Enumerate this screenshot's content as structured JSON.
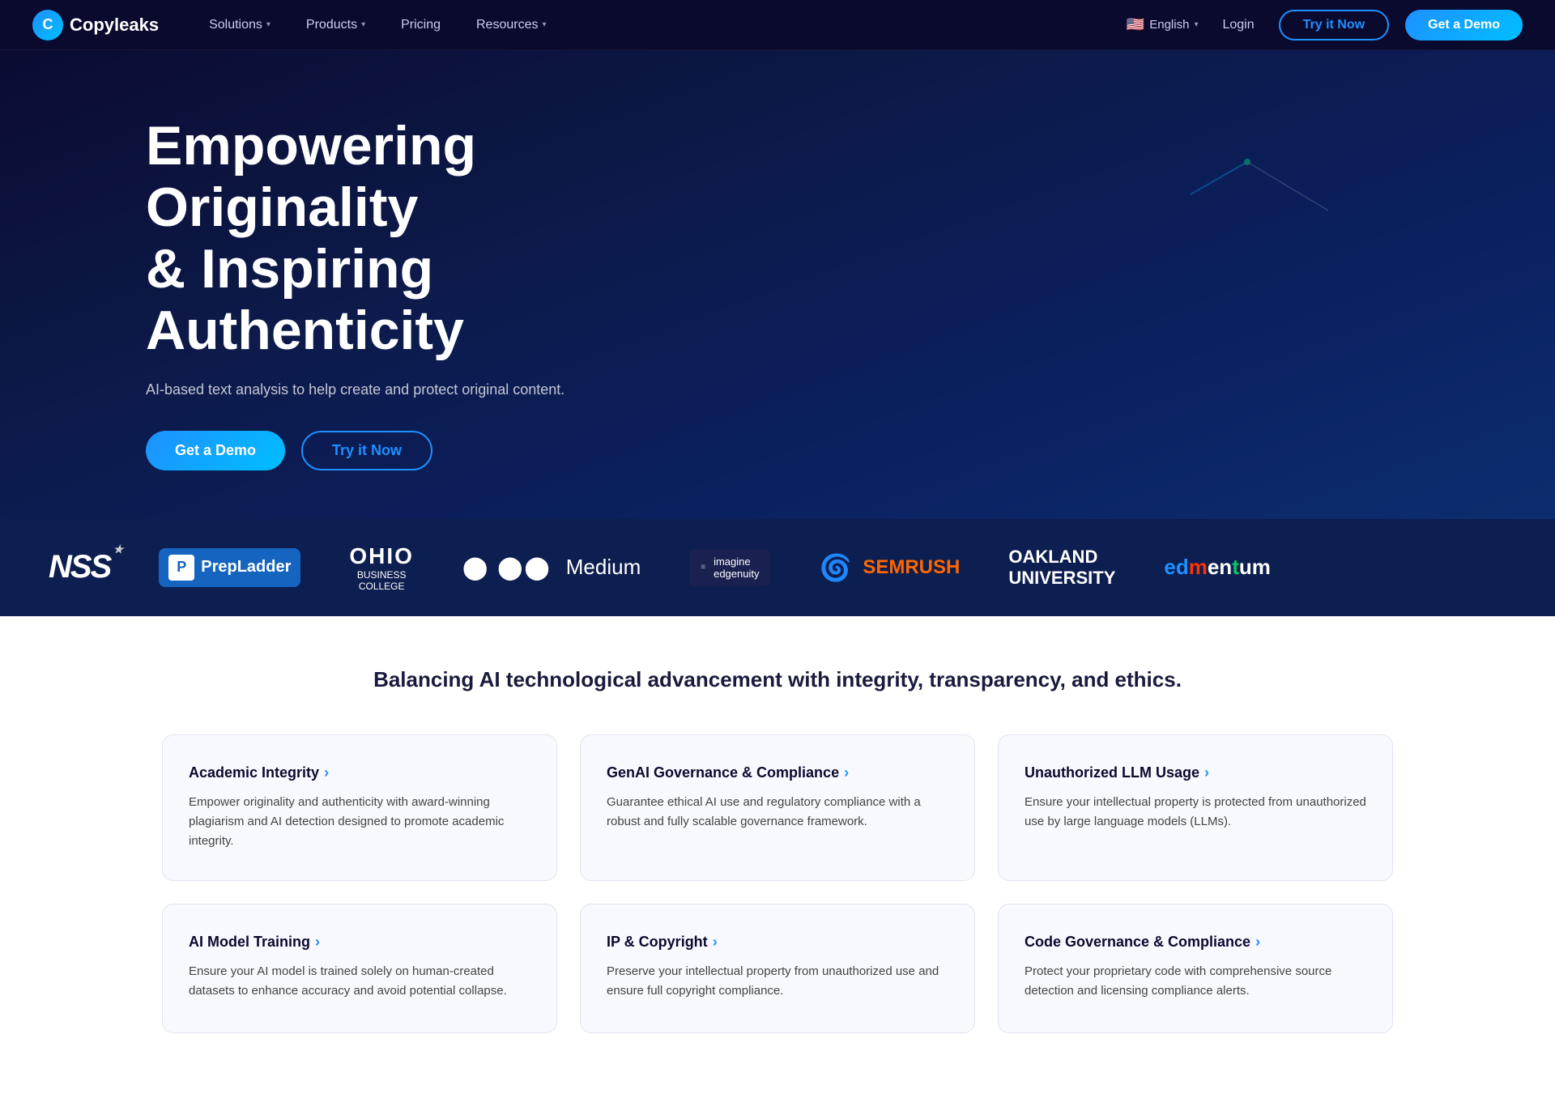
{
  "brand": {
    "logo_letter": "C",
    "logo_name": "Copyleaks"
  },
  "navbar": {
    "solutions_label": "Solutions",
    "products_label": "Products",
    "pricing_label": "Pricing",
    "resources_label": "Resources",
    "language": "English",
    "login_label": "Login",
    "try_btn_label": "Try it Now",
    "demo_btn_label": "Get a Demo"
  },
  "hero": {
    "title_line1": "Empowering Originality",
    "title_line2": "& Inspiring Authenticity",
    "subtitle": "AI-based text analysis to help create and protect original content.",
    "demo_btn": "Get a Demo",
    "try_btn": "Try it Now"
  },
  "logos": [
    {
      "id": "nss",
      "text": "NSS"
    },
    {
      "id": "prepladder",
      "text": "PrepLadder"
    },
    {
      "id": "ohio",
      "text": "OHIO BUSINESS COLLEGE"
    },
    {
      "id": "medium",
      "text": "● ●● Medium"
    },
    {
      "id": "imagine",
      "text": "imagine edgenuity"
    },
    {
      "id": "semrush",
      "text": "SEMRUSH"
    },
    {
      "id": "oakland",
      "text": "OAKLAND UNIVERSITY"
    },
    {
      "id": "edmentum",
      "text": "edmentum"
    }
  ],
  "features": {
    "headline": "Balancing AI technological advancement with integrity, transparency, and ethics.",
    "cards": [
      {
        "id": "academic-integrity",
        "title": "Academic Integrity",
        "description": "Empower originality and authenticity with award-winning plagiarism and AI detection designed to promote academic integrity."
      },
      {
        "id": "genai-governance",
        "title": "GenAI Governance & Compliance",
        "description": "Guarantee ethical AI use and regulatory compliance with a robust and fully scalable governance framework."
      },
      {
        "id": "unauthorized-llm",
        "title": "Unauthorized LLM Usage",
        "description": "Ensure your intellectual property is protected from unauthorized use by large language models (LLMs)."
      },
      {
        "id": "ai-model-training",
        "title": "AI Model Training",
        "description": "Ensure your AI model is trained solely on human-created datasets to enhance accuracy and avoid potential collapse."
      },
      {
        "id": "ip-copyright",
        "title": "IP & Copyright",
        "description": "Preserve your intellectual property from unauthorized use and ensure full copyright compliance."
      },
      {
        "id": "code-governance",
        "title": "Code Governance & Compliance",
        "description": "Protect your proprietary code with comprehensive source detection and licensing compliance alerts."
      }
    ]
  }
}
